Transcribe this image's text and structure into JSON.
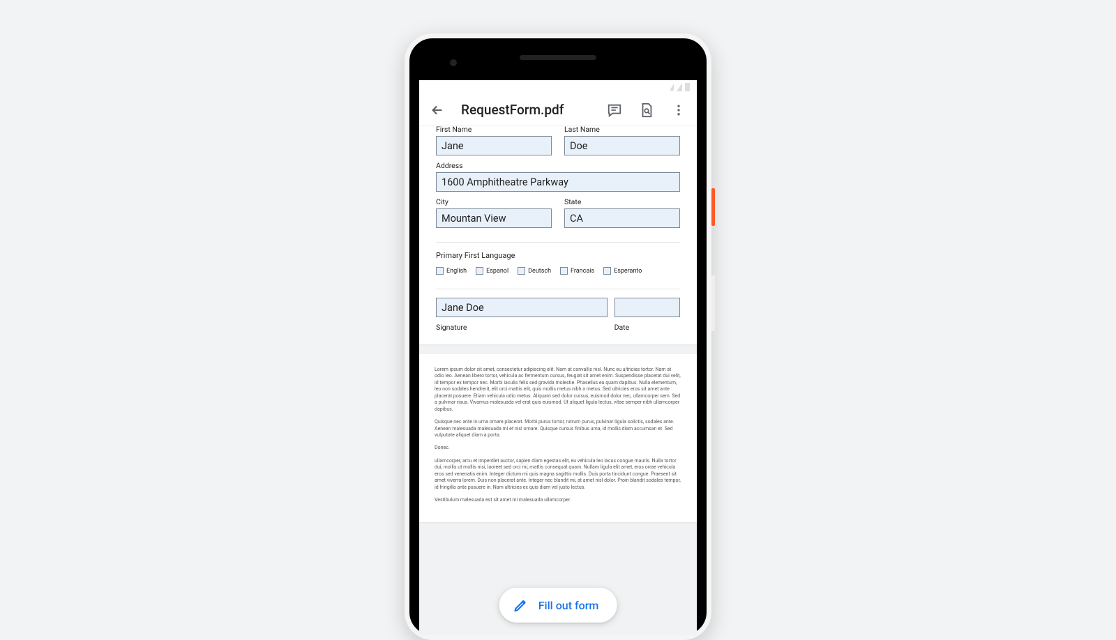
{
  "app_bar": {
    "title": "RequestForm.pdf"
  },
  "form": {
    "first_name_label": "First Name",
    "first_name": "Jane",
    "last_name_label": "Last Name",
    "last_name": "Doe",
    "address_label": "Address",
    "address": "1600 Amphitheatre Parkway",
    "city_label": "City",
    "city": "Mountan View",
    "state_label": "State",
    "state": "CA",
    "language_section": "Primary First Language",
    "languages": {
      "english": "English",
      "espanol": "Espanol",
      "deutsch": "Deutsch",
      "francais": "Francais",
      "esperanto": "Esperanto"
    },
    "signature_label": "Signature",
    "signature": "Jane Doe",
    "date_label": "Date",
    "date": ""
  },
  "body_text": {
    "p1": "Lorem ipsum dolor sit amet, consectetur adipiscing elit. Nam at convallis nisl. Nunc eu ultricies tortor. Nam at odio leo. Aenean libero tortor, vehicula ac fermentum cursus, feugiat sit amet enim. Suspendisse placerat dui velit, id tempor ex tempor nec. Morbi iaculis felis sed gravida molestie. Phasellus eu quam dapibus. Nulla elementum, leo non sodales hendrerit, elit orci mattis elit, quis mollis metus nibh a metus. Sed ultricies eros sit amet ante placerat posuere. Etiam vehicula odio metus. Aliquam sed dolor cursus, euismod dolor nec, ullamcorper sem. Sed a pulvinar risus. Vivamus malesuada vel erat quis euismod. Ut aliquet ligula lectus, vitae semper nibh ullamcorper dapibus.",
    "p2": "Quisque nec ante in urna ornare placerat. Morbi purus tortor, rutrum purus, pulvinar ligula solictis, sodales ante. Aenean malesuada malesuada mi et nisl ornare. Quisque cursus finibus urna, id mollis diam accumsan et. Sed vulputate aliquet diam a porta.",
    "p3": "Donec.",
    "p4": "ullamcorper, arcu et imperdiet auctor, sapien diam egestas elit, eu vehicula leo lacus congue mauris. Nulla tortor dui, mollis ut mollis nisi, laoreet sed orci mi, mattis consequat quam. Nullam ligula elit amet, eros orrae vehicula eros sed venenatis enim. Integer dictum mi quis magna sagittis mollis. Duis porta tincidunt congue. Praesent sit amet viverra lorem. Duis non placerat ante. Integer nec blandit mi, at amet nisl dolor. Proin blandit sodales tempor, id fringilla ante posuere in. Nam ultricies ex quis diam vel justo lectus.",
    "p5": "Vestibulum malesuada est sit amet mi malesuada ullamcorper."
  },
  "fab": {
    "label": "Fill out form"
  }
}
